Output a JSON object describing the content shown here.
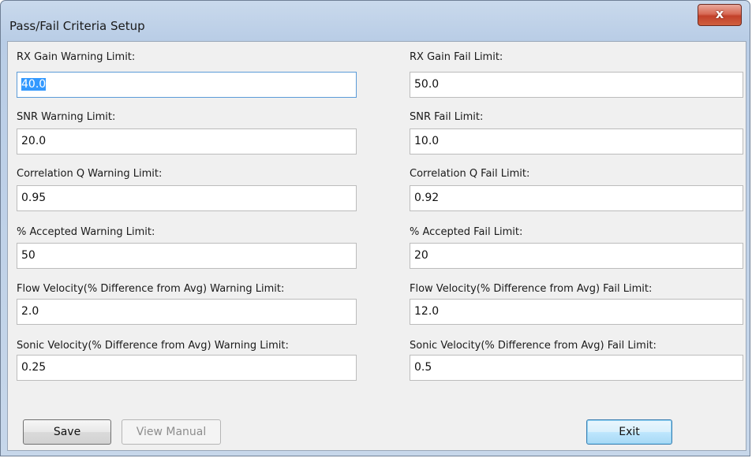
{
  "window": {
    "title": "Pass/Fail Criteria Setup",
    "close_label": "x"
  },
  "fields": {
    "rx_gain_warning": {
      "label": "RX Gain Warning Limit:",
      "value": "40.0"
    },
    "rx_gain_fail": {
      "label": "RX Gain Fail Limit:",
      "value": "50.0"
    },
    "snr_warning": {
      "label": "SNR Warning Limit:",
      "value": "20.0"
    },
    "snr_fail": {
      "label": "SNR Fail Limit:",
      "value": "10.0"
    },
    "corr_q_warning": {
      "label": "Correlation Q Warning Limit:",
      "value": "0.95"
    },
    "corr_q_fail": {
      "label": "Correlation Q Fail Limit:",
      "value": "0.92"
    },
    "accepted_warning": {
      "label": "% Accepted Warning Limit:",
      "value": "50"
    },
    "accepted_fail": {
      "label": "% Accepted Fail Limit:",
      "value": "20"
    },
    "flow_velocity_warning": {
      "label": "Flow Velocity(% Difference from Avg) Warning Limit:",
      "value": "2.0"
    },
    "flow_velocity_fail": {
      "label": "Flow Velocity(% Difference from Avg) Fail Limit:",
      "value": "12.0"
    },
    "sonic_velocity_warning": {
      "label": "Sonic Velocity(% Difference from Avg) Warning Limit:",
      "value": "0.25"
    },
    "sonic_velocity_fail": {
      "label": "Sonic Velocity(% Difference from Avg) Fail Limit:",
      "value": "0.5"
    }
  },
  "buttons": {
    "save": "Save",
    "view_manual": "View Manual",
    "exit": "Exit"
  }
}
